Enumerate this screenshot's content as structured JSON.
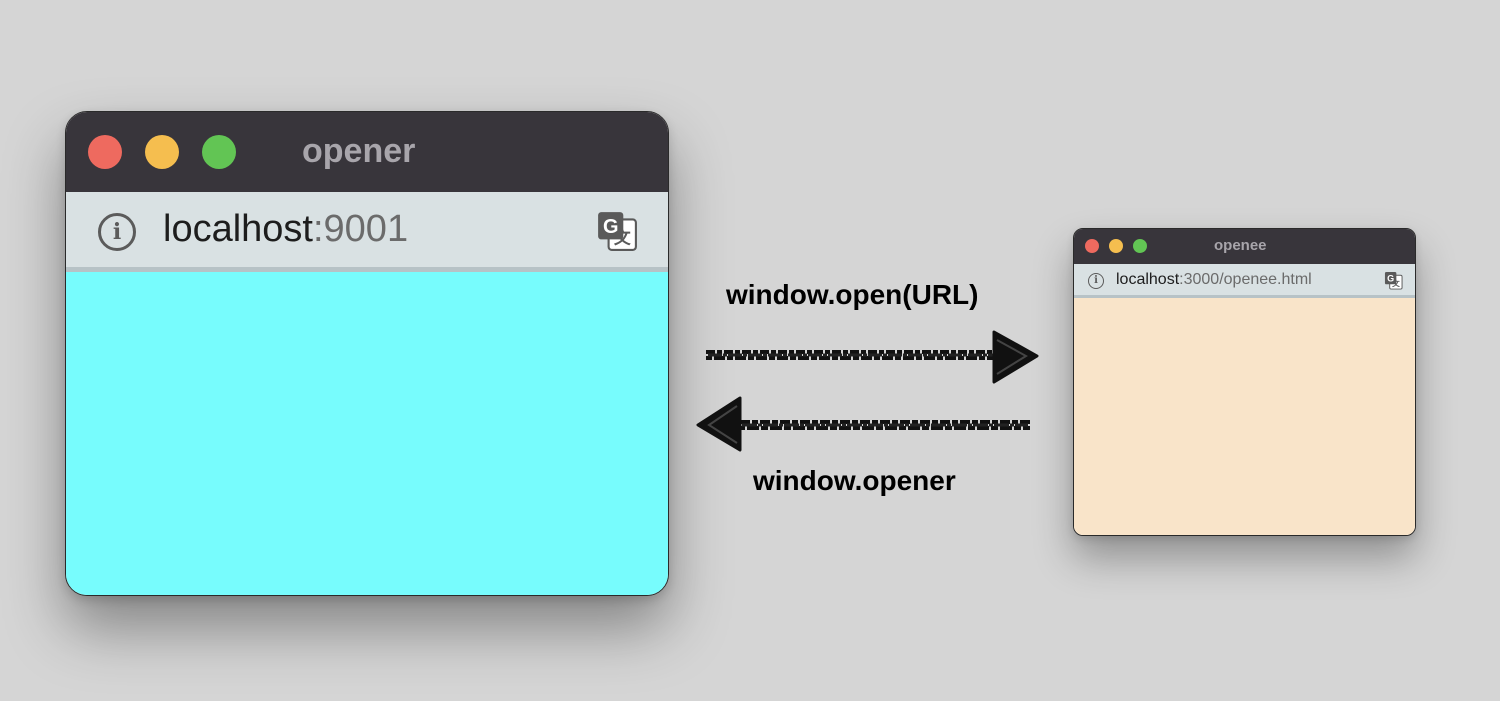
{
  "opener_window": {
    "title": "opener",
    "url_host": "localhost",
    "url_rest": ":9001",
    "content_color": "#77fcfd",
    "titlebar_color": "#38353b",
    "title_color": "#a8a5ab",
    "addressbar_color": "#d9e1e3"
  },
  "openee_window": {
    "title": "openee",
    "url_host": "localhost",
    "url_rest": ":3000/openee.html",
    "content_color": "#f9e4c9",
    "titlebar_color": "#38353b",
    "title_color": "#a8a5ab",
    "addressbar_color": "#d9e1e3"
  },
  "traffic_lights": {
    "close_color": "#ee6a5f",
    "minimize_color": "#f5be4f",
    "zoom_color": "#62c554"
  },
  "arrows": {
    "forward_label": "window.open(URL)",
    "back_label": "window.opener",
    "forward_direction": "right",
    "back_direction": "left"
  },
  "icons": {
    "info": "info-icon",
    "info_glyph": "i",
    "translate": "translate-icon"
  }
}
